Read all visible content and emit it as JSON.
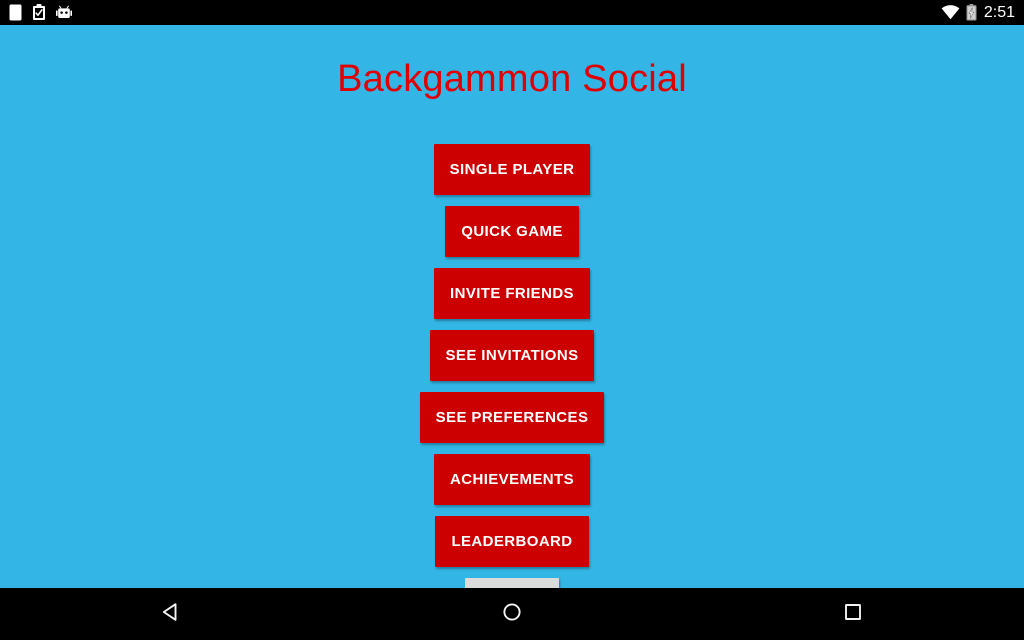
{
  "status_bar": {
    "left_icons": [
      {
        "name": "sim-card-icon",
        "label": "SIM card"
      },
      {
        "name": "clipboard-check-icon",
        "label": "Clipboard"
      },
      {
        "name": "android-robot-icon",
        "label": "Android"
      }
    ],
    "right_icons": [
      {
        "name": "wifi-icon",
        "label": "Wi-Fi"
      },
      {
        "name": "battery-charging-icon",
        "label": "Battery charging"
      }
    ],
    "clock": "2:51"
  },
  "app": {
    "title": "Backgammon Social",
    "background_color": "#33b5e5",
    "title_color": "#e00000",
    "button_color": "#cc0000",
    "button_text_color": "#ffffff",
    "disabled_button_color": "#dcdcdc",
    "menu_buttons": [
      {
        "label": "SINGLE PLAYER",
        "name": "single-player-button",
        "state": "enabled"
      },
      {
        "label": "QUICK GAME",
        "name": "quick-game-button",
        "state": "enabled"
      },
      {
        "label": "INVITE FRIENDS",
        "name": "invite-friends-button",
        "state": "enabled"
      },
      {
        "label": "SEE INVITATIONS",
        "name": "see-invitations-button",
        "state": "enabled"
      },
      {
        "label": "SEE PREFERENCES",
        "name": "see-preferences-button",
        "state": "enabled"
      },
      {
        "label": "ACHIEVEMENTS",
        "name": "achievements-button",
        "state": "enabled"
      },
      {
        "label": "LEADERBOARD",
        "name": "leaderboard-button",
        "state": "enabled"
      },
      {
        "label": "",
        "name": "partially-visible-button",
        "state": "disabled"
      }
    ]
  },
  "nav_bar": {
    "buttons": [
      {
        "name": "nav-back-button",
        "label": "Back"
      },
      {
        "name": "nav-home-button",
        "label": "Home"
      },
      {
        "name": "nav-recents-button",
        "label": "Recent apps"
      }
    ]
  }
}
